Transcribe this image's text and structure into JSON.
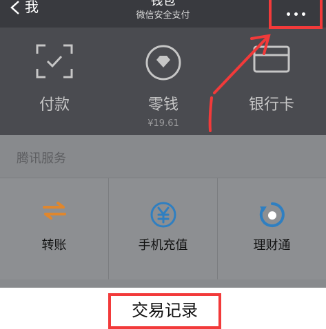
{
  "nav": {
    "back_label": "我",
    "title": "钱包",
    "subtitle": "微信安全支付",
    "more_icon": "more-dots-icon"
  },
  "wallet": {
    "items": [
      {
        "label": "付款",
        "icon": "scan-pay-icon"
      },
      {
        "label": "零钱",
        "sub": "¥19.61",
        "icon": "diamond-coin-icon"
      },
      {
        "label": "银行卡",
        "icon": "bank-card-icon"
      }
    ]
  },
  "services": {
    "header": "腾讯服务",
    "items": [
      {
        "label": "转账",
        "icon": "transfer-arrows-icon",
        "color": "#e0872d"
      },
      {
        "label": "手机充值",
        "icon": "yuan-recharge-icon",
        "color": "#2f7fc1"
      },
      {
        "label": "理财通",
        "icon": "wealth-circle-icon",
        "color": "#2f7fc1"
      }
    ]
  },
  "bottom_menu": {
    "tx_record_label": "交易记录"
  },
  "colors": {
    "nav_bg": "#393a3f",
    "annotation_red": "#f23a3a"
  }
}
